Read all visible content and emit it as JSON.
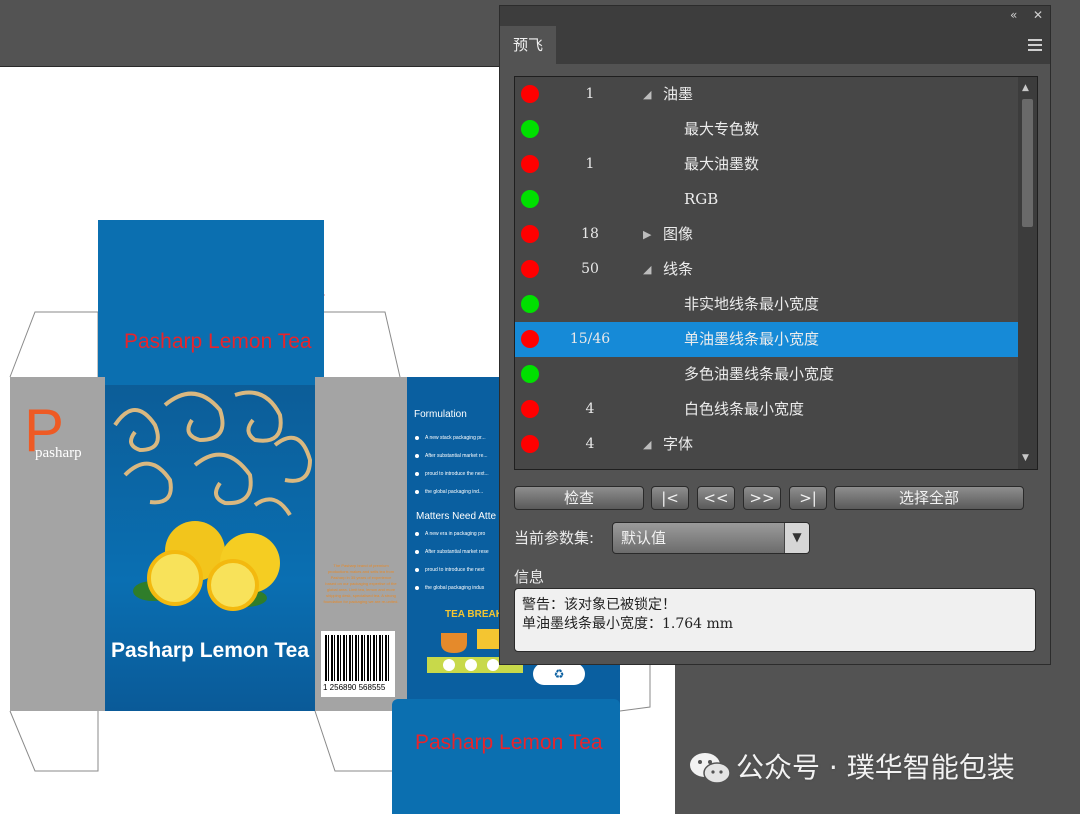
{
  "artwork": {
    "flap_title_top": "Pasharp Lemon Tea",
    "flap_title_bottom": "Pasharp Lemon Tea",
    "logo_letter": "P",
    "logo_text": "pasharp",
    "front_title": "Pasharp Lemon Tea",
    "side_heading_1": "Formulation",
    "side_lines_1": [
      "A new stack packaging pr...",
      "After substantial market re...",
      "proud to introduce the next...",
      "the global packaging ind..."
    ],
    "side_heading_2": "Matters Need Atte",
    "side_lines_2": [
      "A new era in packaging pro",
      "After substantial market rese",
      "proud to introduce the next",
      "the global packaging indus"
    ],
    "barcode_number": "1 256890 568555",
    "badge_text": "TEA BREAK"
  },
  "panel": {
    "tab_label": "预飞",
    "collapse_icon": "double-chevron-left-icon",
    "close_icon": "close-icon",
    "menu_icon": "hamburger-menu-icon",
    "colors": {
      "error": "#ff0000",
      "ok": "#00e000",
      "selected": "#168ad7"
    },
    "checks": [
      {
        "status": "error",
        "count": "1",
        "twisty": "expanded",
        "label": "油墨",
        "level": 0
      },
      {
        "status": "ok",
        "count": "",
        "twisty": "",
        "label": "最大专色数",
        "level": 1
      },
      {
        "status": "error",
        "count": "1",
        "twisty": "",
        "label": "最大油墨数",
        "level": 1
      },
      {
        "status": "ok",
        "count": "",
        "twisty": "",
        "label": "RGB",
        "level": 1
      },
      {
        "status": "error",
        "count": "18",
        "twisty": "collapsed",
        "label": "图像",
        "level": 0
      },
      {
        "status": "error",
        "count": "50",
        "twisty": "expanded",
        "label": "线条",
        "level": 0
      },
      {
        "status": "ok",
        "count": "",
        "twisty": "",
        "label": "非实地线条最小宽度",
        "level": 1
      },
      {
        "status": "error",
        "count": "15/46",
        "twisty": "",
        "label": "单油墨线条最小宽度",
        "level": 1,
        "selected": true
      },
      {
        "status": "ok",
        "count": "",
        "twisty": "",
        "label": "多色油墨线条最小宽度",
        "level": 1
      },
      {
        "status": "error",
        "count": "4",
        "twisty": "",
        "label": "白色线条最小宽度",
        "level": 1
      },
      {
        "status": "error",
        "count": "4",
        "twisty": "expanded",
        "label": "字体",
        "level": 0
      }
    ],
    "buttons": {
      "check": "检查",
      "first": "|<",
      "prev": "<<",
      "next": ">>",
      "last": ">|",
      "select_all": "选择全部"
    },
    "param_set_label": "当前参数集:",
    "param_set_value": "默认值",
    "info_label": "信息",
    "info_lines": [
      "警告：该对象已被锁定！",
      "单油墨线条最小宽度：1.764 mm"
    ]
  },
  "watermark": {
    "text": "公众号 · 璞华智能包装",
    "icon": "wechat-icon"
  }
}
